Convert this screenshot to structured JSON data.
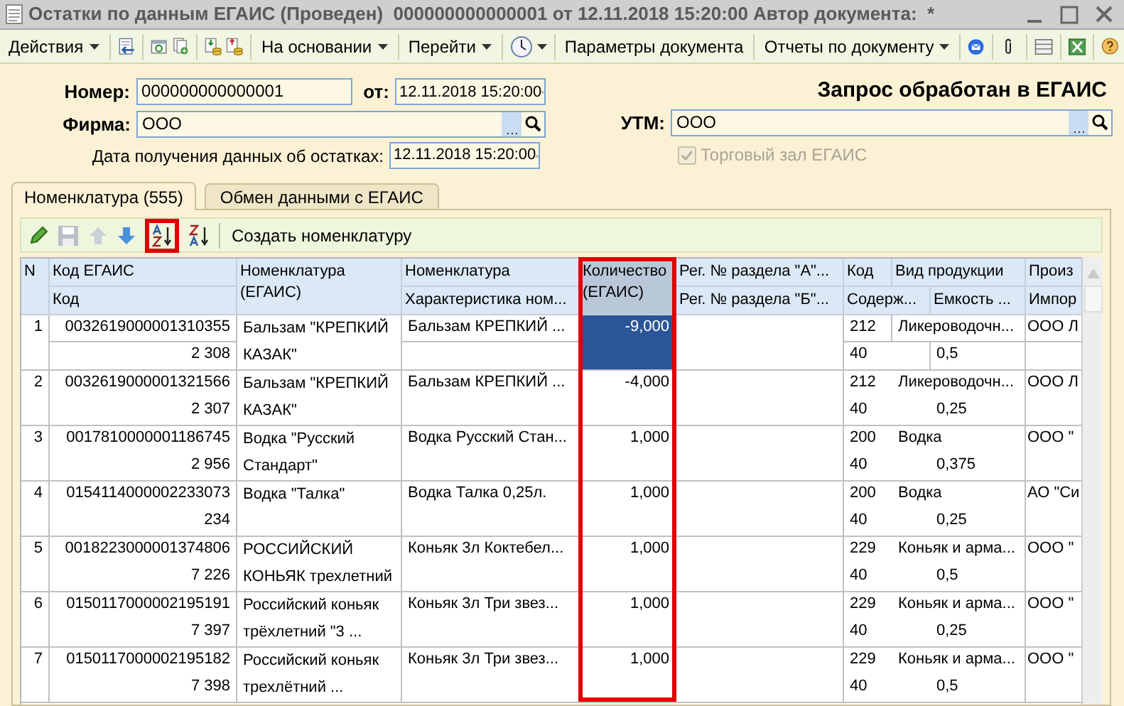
{
  "window": {
    "title": "Остатки по данным ЕГАИС (Проведен)  000000000000001 от 12.11.2018 15:20:00 Автор документа:  *"
  },
  "toolbar": {
    "buttons": [
      {
        "label": "Действия",
        "dropdown": true
      },
      {
        "label": "На основании",
        "dropdown": true
      },
      {
        "label": "Перейти",
        "dropdown": true
      },
      {
        "label": "Параметры документа",
        "dropdown": false
      },
      {
        "label": "Отчеты по документу",
        "dropdown": true
      }
    ]
  },
  "form": {
    "number_label": "Номер:",
    "number": "000000000000001",
    "date_label": "от:",
    "date": "12.11.2018 15:20:00",
    "firm_label": "Фирма:",
    "firm": "ООО",
    "received_label": "Дата получения данных об остатках:",
    "received_date": "12.11.2018 15:20:00",
    "status": "Запрос обработан в ЕГАИС",
    "utm_label": "УТМ:",
    "utm": "ООО",
    "trade_hall": {
      "label": "Торговый зал ЕГАИС",
      "checked": true,
      "disabled": true
    }
  },
  "tabs": [
    {
      "label": "Номенклатура (555)",
      "selected": true
    },
    {
      "label": "Обмен данными с ЕГАИС",
      "selected": false
    }
  ],
  "table_toolbar": {
    "save_disabled": true,
    "up_disabled": true,
    "sort_highlighted": true,
    "create_label": "Создать номенклатуру"
  },
  "table": {
    "header": [
      {
        "label": "N"
      },
      {
        "label": "Код ЕГАИС"
      },
      {
        "label": "Номенклатура (ЕГАИС)"
      },
      {
        "label": "Номенклатура"
      },
      {
        "label": "Количество (ЕГАИС)",
        "highlighted": true
      },
      {
        "label": "Рег. № раздела \"А\"..."
      },
      {
        "label": "Код"
      },
      {
        "label": "Вид продукции"
      },
      {
        "label": "Произ"
      },
      {
        "label": "Код"
      },
      {
        "label": "Характеристика ном..."
      },
      {
        "label": "Рег. № раздела \"Б\"..."
      },
      {
        "label": "Содерж..."
      },
      {
        "label": "Емкость ..."
      },
      {
        "label": "Импор"
      }
    ],
    "rows": [
      {
        "n": "1",
        "egais_code": "0032619000001310355",
        "code": "2 308",
        "egais_name": "Бальзам \"КРЕПКИЙ КАЗАК\"",
        "name": "Бальзам КРЕПКИЙ ...",
        "quantity": "-9,000",
        "product_code": "212",
        "product_type": "Ликероводочн...",
        "producer": "ООО Л",
        "content": "40",
        "volume": "0,5",
        "selected": true
      },
      {
        "n": "2",
        "egais_code": "0032619000001321566",
        "code": "2 307",
        "egais_name": "Бальзам \"КРЕПКИЙ КАЗАК\"",
        "name": "Бальзам КРЕПКИЙ ...",
        "quantity": "-4,000",
        "product_code": "212",
        "product_type": "Ликероводочн...",
        "producer": "ООО Л",
        "content": "40",
        "volume": "0,25",
        "selected": false
      },
      {
        "n": "3",
        "egais_code": "0017810000001186745",
        "code": "2 956",
        "egais_name": "Водка \"Русский Стандарт\"",
        "name": "Водка Русский Стан...",
        "quantity": "1,000",
        "product_code": "200",
        "product_type": "Водка",
        "producer": "ООО \"",
        "content": "40",
        "volume": "0,375",
        "selected": false
      },
      {
        "n": "4",
        "egais_code": "0154114000002233073",
        "code": "234",
        "egais_name": "Водка \"Талка\"",
        "name": "Водка Талка  0,25л.",
        "quantity": "1,000",
        "product_code": "200",
        "product_type": "Водка",
        "producer": "АО \"Си",
        "content": "40",
        "volume": "0,25",
        "selected": false
      },
      {
        "n": "5",
        "egais_code": "0018223000001374806",
        "code": "7 226",
        "egais_name": "РОССИЙСКИЙ КОНЬЯК трехлетний",
        "name": "Коньяк 3л Коктебел...",
        "quantity": "1,000",
        "product_code": "229",
        "product_type": "Коньяк и арма...",
        "producer": "ООО \"",
        "content": "40",
        "volume": "0,5",
        "selected": false
      },
      {
        "n": "6",
        "egais_code": "0150117000002195191",
        "code": "7 397",
        "egais_name": "Российский коньяк трёхлетний \"3 ...",
        "name": "Коньяк 3л Три звез...",
        "quantity": "1,000",
        "product_code": "229",
        "product_type": "Коньяк и арма...",
        "producer": "ООО \"",
        "content": "40",
        "volume": "0,25",
        "selected": false
      },
      {
        "n": "7",
        "egais_code": "0150117000002195182",
        "code": "7 398",
        "egais_name": "Российский коньяк трехлётний ...",
        "name": "Коньяк 3л Три звез...",
        "quantity": "1,000",
        "product_code": "229",
        "product_type": "Коньяк и арма...",
        "producer": "ООО \"",
        "content": "40",
        "volume": "0,5",
        "selected": false
      }
    ]
  }
}
